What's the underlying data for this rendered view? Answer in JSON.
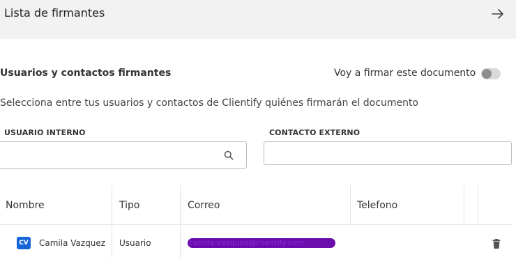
{
  "header": {
    "title": "Lista de firmantes",
    "close_icon": "arrow-right-icon"
  },
  "section": {
    "title": "Usuarios y contactos firmantes",
    "toggle_label": "Voy a firmar este documento",
    "toggle_on": false,
    "description": "Selecciona entre tus usuarios y contactos de Clientify quiénes firmarán el documento"
  },
  "fields": {
    "internal": {
      "label": "USUARIO INTERNO",
      "value": "",
      "icon": "search-icon"
    },
    "external": {
      "label": "CONTACTO EXTERNO",
      "value": ""
    }
  },
  "table": {
    "headers": [
      "Nombre",
      "Tipo",
      "Correo",
      "Telefono"
    ],
    "rows": [
      {
        "initials": "CV",
        "name": "Camila Vazquez",
        "type": "Usuario",
        "email": "camila.vazquez@clientify.com",
        "phone": ""
      }
    ]
  },
  "colors": {
    "avatar": "#1565d8",
    "redaction": "#6a0dad",
    "header_bg": "#f2f2f2"
  }
}
